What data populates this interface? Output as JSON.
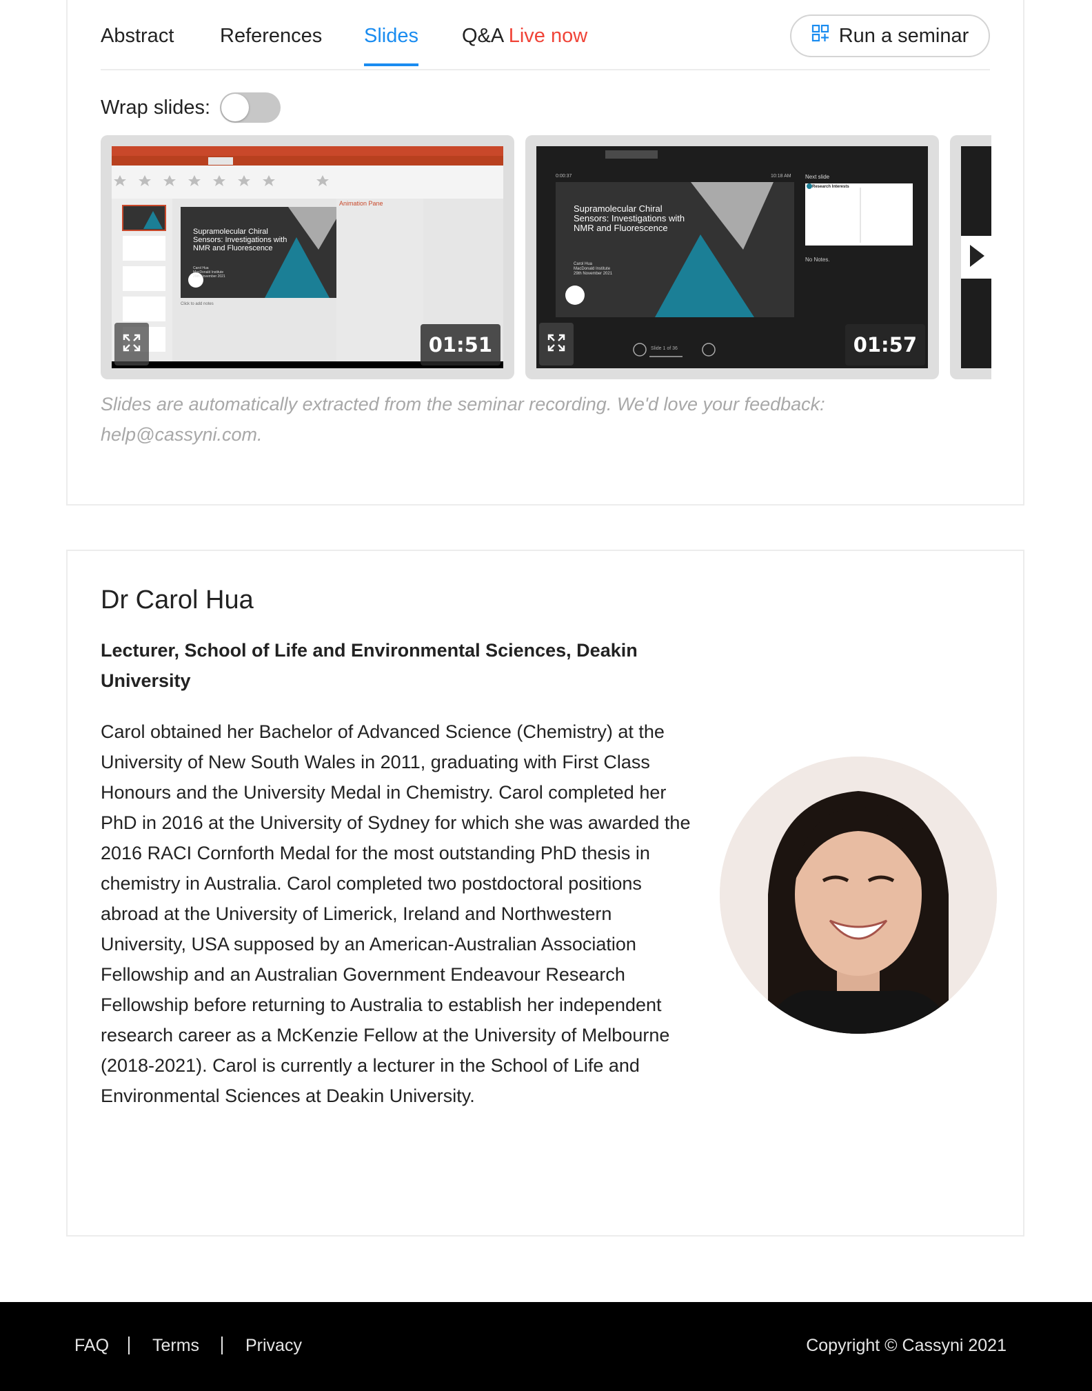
{
  "tabs": [
    {
      "label": "Abstract"
    },
    {
      "label": "References"
    },
    {
      "label": "Slides"
    },
    {
      "label": "Q&A",
      "badge": "Live now"
    }
  ],
  "active_tab": "Slides",
  "run_seminar": {
    "label": "Run a seminar"
  },
  "wrap_slides": {
    "label": "Wrap slides:",
    "enabled": false
  },
  "slides": [
    {
      "time": "01:51",
      "slide_title": "Supramolecular Chiral Sensors: Investigations with NMR and Fluorescence",
      "slide_speaker": "Carol Hua",
      "slide_affiliation": "MacDonald Institute",
      "slide_date": "29th November 2021",
      "ppt_pane": "Animation Pane",
      "ppt_notes": "Click to add notes"
    },
    {
      "time": "01:57",
      "slide_title": "Supramolecular Chiral Sensors: Investigations with NMR and Fluorescence",
      "slide_speaker": "Carol Hua",
      "slide_affiliation": "MacDonald Institute",
      "slide_date": "29th November 2021",
      "presenter_elapsed": "0:00:37",
      "presenter_clock": "10:18 AM",
      "next_slide": "Next slide",
      "next_slide_title": "Research Interests",
      "no_notes": "No Notes.",
      "slide_counter": "Slide 1 of 36"
    }
  ],
  "slides_caption": "Slides are automatically extracted from the seminar recording. We'd love your feedback: help@cassyni.com.",
  "speaker": {
    "name": "Dr Carol Hua",
    "title": "Lecturer, School of Life and Environmental Sciences, Deakin University",
    "bio": "Carol obtained her Bachelor of Advanced Science (Chemistry) at the University of New South Wales in 2011, graduating with First Class Honours and the University Medal in Chemistry. Carol completed her PhD in 2016 at the University of Sydney for which she was awarded the 2016 RACI Cornforth Medal for the most outstanding PhD thesis in chemistry in Australia. Carol completed two postdoctoral positions abroad at the University of Limerick, Ireland and Northwestern University, USA supposed by an American-Australian Association Fellowship and an Australian Government Endeavour Research Fellowship before returning to Australia to establish her independent research career as a McKenzie Fellow at the University of Melbourne (2018-2021). Carol is currently a lecturer in the School of Life and Environmental Sciences at Deakin University."
  },
  "footer": {
    "links": [
      "FAQ",
      "Terms",
      "Privacy"
    ],
    "copyright": "Copyright © Cassyni 2021"
  },
  "colors": {
    "accent": "#1a8cf0",
    "live": "#f04438",
    "footer_bg": "#000000"
  },
  "icons": {
    "run_seminar": "grid-plus-icon",
    "expand": "expand-icon",
    "next": "play-arrow-icon"
  }
}
